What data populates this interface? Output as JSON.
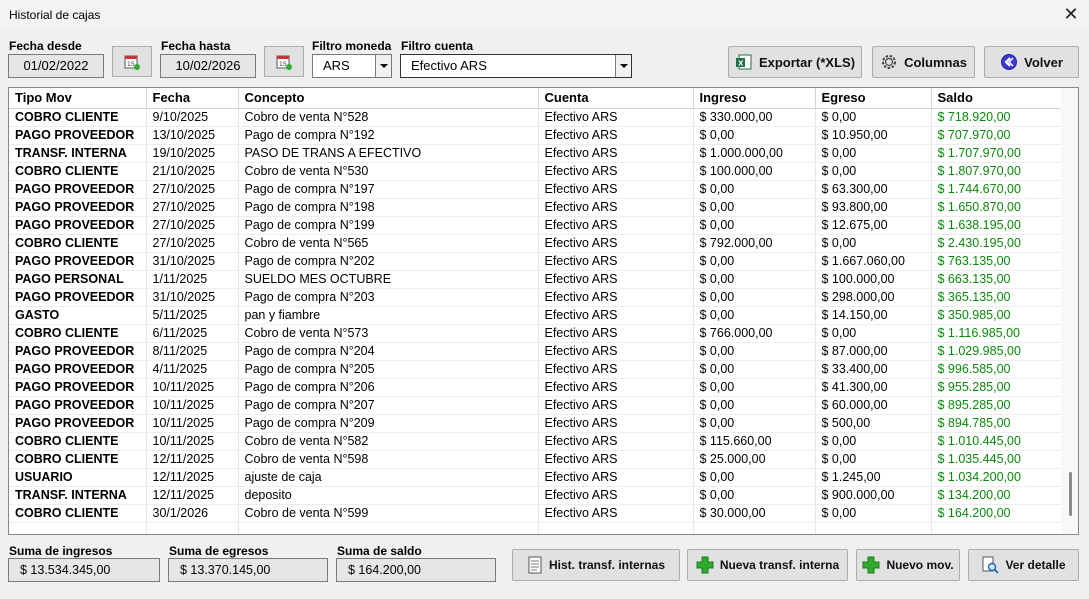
{
  "window": {
    "title": "Historial de cajas",
    "close_glyph": "✕"
  },
  "filters": {
    "fecha_desde_label": "Fecha desde",
    "fecha_desde": "01/02/2022",
    "fecha_hasta_label": "Fecha hasta",
    "fecha_hasta": "10/02/2026",
    "moneda_label": "Filtro moneda",
    "moneda": "ARS",
    "cuenta_label": "Filtro cuenta",
    "cuenta": "Efectivo ARS"
  },
  "toolbar": {
    "exportar": "Exportar (*XLS)",
    "columnas": "Columnas",
    "volver": "Volver"
  },
  "table": {
    "columns": [
      "Tipo Mov",
      "Fecha",
      "Concepto",
      "Cuenta",
      "Ingreso",
      "Egreso",
      "Saldo"
    ],
    "rows": [
      [
        "COBRO CLIENTE",
        "9/10/2025",
        "Cobro de venta N°528",
        "Efectivo ARS",
        "$ 330.000,00",
        "$ 0,00",
        "$ 718.920,00"
      ],
      [
        "PAGO PROVEEDOR",
        "13/10/2025",
        "Pago de compra N°192",
        "Efectivo ARS",
        "$ 0,00",
        "$ 10.950,00",
        "$ 707.970,00"
      ],
      [
        "TRANSF. INTERNA",
        "19/10/2025",
        "PASO DE TRANS A EFECTIVO",
        "Efectivo ARS",
        "$ 1.000.000,00",
        "$ 0,00",
        "$ 1.707.970,00"
      ],
      [
        "COBRO CLIENTE",
        "21/10/2025",
        "Cobro de venta N°530",
        "Efectivo ARS",
        "$ 100.000,00",
        "$ 0,00",
        "$ 1.807.970,00"
      ],
      [
        "PAGO PROVEEDOR",
        "27/10/2025",
        "Pago de compra N°197",
        "Efectivo ARS",
        "$ 0,00",
        "$ 63.300,00",
        "$ 1.744.670,00"
      ],
      [
        "PAGO PROVEEDOR",
        "27/10/2025",
        "Pago de compra N°198",
        "Efectivo ARS",
        "$ 0,00",
        "$ 93.800,00",
        "$ 1.650.870,00"
      ],
      [
        "PAGO PROVEEDOR",
        "27/10/2025",
        "Pago de compra N°199",
        "Efectivo ARS",
        "$ 0,00",
        "$ 12.675,00",
        "$ 1.638.195,00"
      ],
      [
        "COBRO CLIENTE",
        "27/10/2025",
        "Cobro de venta N°565",
        "Efectivo ARS",
        "$ 792.000,00",
        "$ 0,00",
        "$ 2.430.195,00"
      ],
      [
        "PAGO PROVEEDOR",
        "31/10/2025",
        "Pago de compra N°202",
        "Efectivo ARS",
        "$ 0,00",
        "$ 1.667.060,00",
        "$ 763.135,00"
      ],
      [
        "PAGO PERSONAL",
        "1/11/2025",
        "SUELDO MES OCTUBRE",
        "Efectivo ARS",
        "$ 0,00",
        "$ 100.000,00",
        "$ 663.135,00"
      ],
      [
        "PAGO PROVEEDOR",
        "31/10/2025",
        "Pago de compra N°203",
        "Efectivo ARS",
        "$ 0,00",
        "$ 298.000,00",
        "$ 365.135,00"
      ],
      [
        "GASTO",
        "5/11/2025",
        "pan y fiambre",
        "Efectivo ARS",
        "$ 0,00",
        "$ 14.150,00",
        "$ 350.985,00"
      ],
      [
        "COBRO CLIENTE",
        "6/11/2025",
        "Cobro de venta N°573",
        "Efectivo ARS",
        "$ 766.000,00",
        "$ 0,00",
        "$ 1.116.985,00"
      ],
      [
        "PAGO PROVEEDOR",
        "8/11/2025",
        "Pago de compra N°204",
        "Efectivo ARS",
        "$ 0,00",
        "$ 87.000,00",
        "$ 1.029.985,00"
      ],
      [
        "PAGO PROVEEDOR",
        "4/11/2025",
        "Pago de compra N°205",
        "Efectivo ARS",
        "$ 0,00",
        "$ 33.400,00",
        "$ 996.585,00"
      ],
      [
        "PAGO PROVEEDOR",
        "10/11/2025",
        "Pago de compra N°206",
        "Efectivo ARS",
        "$ 0,00",
        "$ 41.300,00",
        "$ 955.285,00"
      ],
      [
        "PAGO PROVEEDOR",
        "10/11/2025",
        "Pago de compra N°207",
        "Efectivo ARS",
        "$ 0,00",
        "$ 60.000,00",
        "$ 895.285,00"
      ],
      [
        "PAGO PROVEEDOR",
        "10/11/2025",
        "Pago de compra N°209",
        "Efectivo ARS",
        "$ 0,00",
        "$ 500,00",
        "$ 894.785,00"
      ],
      [
        "COBRO CLIENTE",
        "10/11/2025",
        "Cobro de venta N°582",
        "Efectivo ARS",
        "$ 115.660,00",
        "$ 0,00",
        "$ 1.010.445,00"
      ],
      [
        "COBRO CLIENTE",
        "12/11/2025",
        "Cobro de venta N°598",
        "Efectivo ARS",
        "$ 25.000,00",
        "$ 0,00",
        "$ 1.035.445,00"
      ],
      [
        "USUARIO",
        "12/11/2025",
        "ajuste de caja",
        "Efectivo ARS",
        "$ 0,00",
        "$ 1.245,00",
        "$ 1.034.200,00"
      ],
      [
        "TRANSF. INTERNA",
        "12/11/2025",
        "deposito",
        "Efectivo ARS",
        "$ 0,00",
        "$ 900.000,00",
        "$ 134.200,00"
      ],
      [
        "COBRO CLIENTE",
        "30/1/2026",
        "Cobro de venta N°599",
        "Efectivo ARS",
        "$ 30.000,00",
        "$ 0,00",
        "$ 164.200,00"
      ]
    ]
  },
  "totals": {
    "ingresos_label": "Suma de ingresos",
    "ingresos": "$ 13.534.345,00",
    "egresos_label": "Suma de egresos",
    "egresos": "$ 13.370.145,00",
    "saldo_label": "Suma de saldo",
    "saldo": "$ 164.200,00"
  },
  "footer_buttons": {
    "hist": "Hist. transf. internas",
    "nueva_transf": "Nueva transf. interna",
    "nuevo_mov": "Nuevo mov.",
    "ver_detalle": "Ver detalle"
  },
  "colors": {
    "saldo_green": "#0a8a0a",
    "plus_green": "#2eaa2e",
    "excel_green": "#1e7145",
    "back_blue": "#3a3ad0"
  }
}
